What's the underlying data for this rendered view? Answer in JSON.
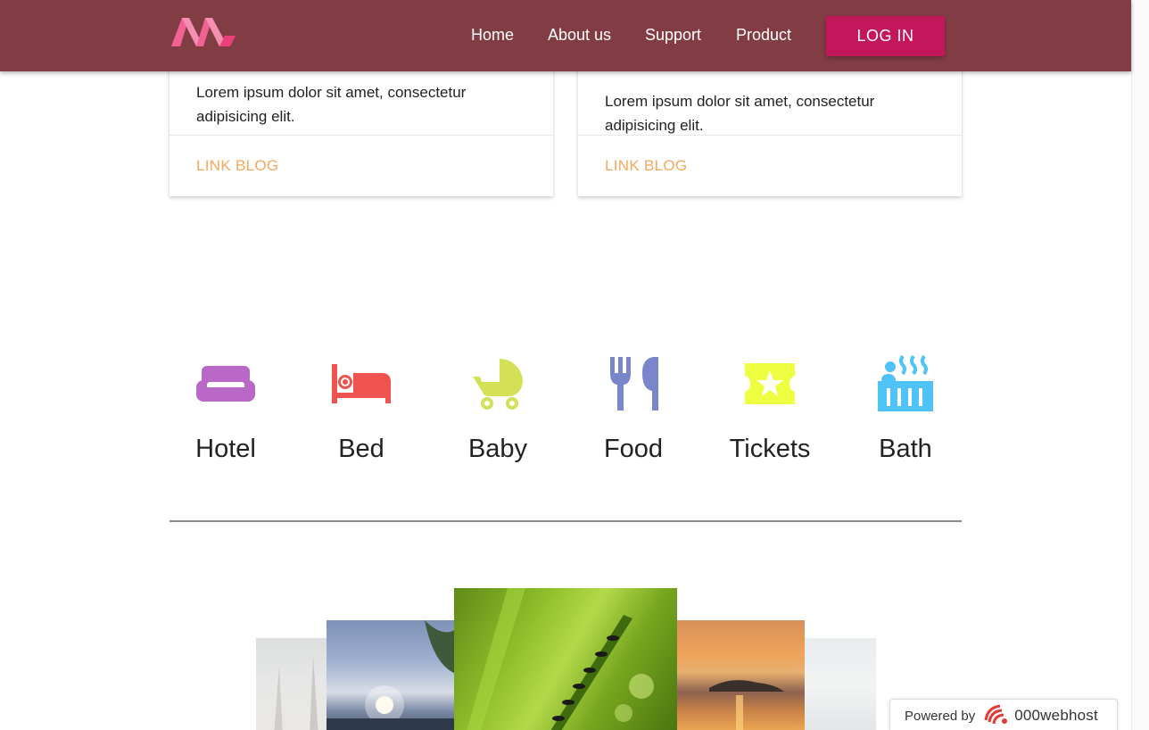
{
  "nav": {
    "links": [
      "Home",
      "About us",
      "Support",
      "Product"
    ],
    "login_label": "LOG IN"
  },
  "cards": [
    {
      "text": "Lorem ipsum dolor sit amet, consectetur adipisicing elit.",
      "link": "LINK BLOG"
    },
    {
      "text": "Lorem ipsum dolor sit amet, consectetur adipisicing elit.",
      "link": "LINK BLOG"
    }
  ],
  "features": [
    {
      "label": "Hotel",
      "icon": "sofa-icon",
      "color": "#ba68c8"
    },
    {
      "label": "Bed",
      "icon": "hotel-bed-icon",
      "color": "#ef5350"
    },
    {
      "label": "Baby",
      "icon": "stroller-icon",
      "color": "#d4e157"
    },
    {
      "label": "Food",
      "icon": "fork-knife-icon",
      "color": "#7986cb"
    },
    {
      "label": "Tickets",
      "icon": "ticket-star-icon",
      "color": "#eeff41"
    },
    {
      "label": "Bath",
      "icon": "hot-tub-icon",
      "color": "#4fc3f7"
    }
  ],
  "carousel": {
    "slides": [
      "tree-photo",
      "tropical-sunset-photo",
      "ants-on-grass-photo",
      "sunset-island-photo",
      "misty-sea-photo"
    ]
  },
  "footer_badge": {
    "powered_label": "Powered by",
    "host_name": "000webhost"
  },
  "colors": {
    "navbar": "#823c43",
    "login_button": "#c2185b",
    "link_accent": "#f6a85a"
  }
}
